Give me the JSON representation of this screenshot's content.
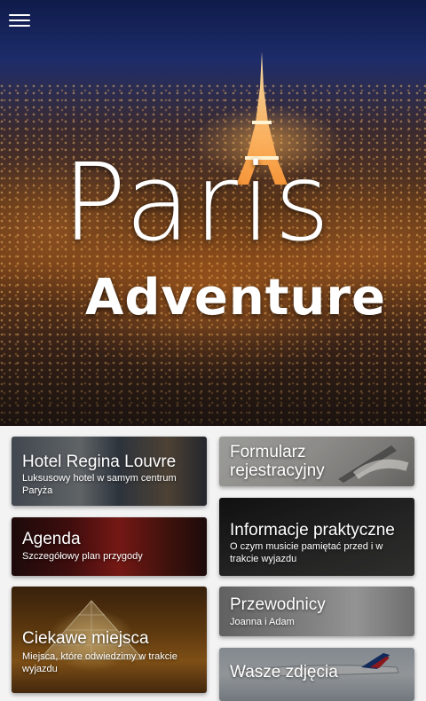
{
  "hero": {
    "title_line1": "Paris",
    "title_line2": "Adventure",
    "menu_icon": "hamburger-menu-icon"
  },
  "tiles": {
    "hotel": {
      "title": "Hotel Regina Louvre",
      "subtitle": "Luksusowy hotel w samym centrum Paryża"
    },
    "form": {
      "title": "Formularz rejestracyjny"
    },
    "info": {
      "title": "Informacje praktyczne",
      "subtitle": "O czym musicie pamiętać przed i w trakcie wyjazdu"
    },
    "agenda": {
      "title": "Agenda",
      "subtitle": "Szczegółowy plan przygody"
    },
    "guides": {
      "title": "Przewodnicy",
      "subtitle": "Joanna i Adam"
    },
    "places": {
      "title": "Ciekawe miejsca",
      "subtitle": "Miejsca, które odwiedzimy w trakcie wyjazdu"
    },
    "photos": {
      "title": "Wasze zdjęcia"
    }
  },
  "colors": {
    "background": "#f3f3f3",
    "text_on_image": "#ffffff"
  }
}
